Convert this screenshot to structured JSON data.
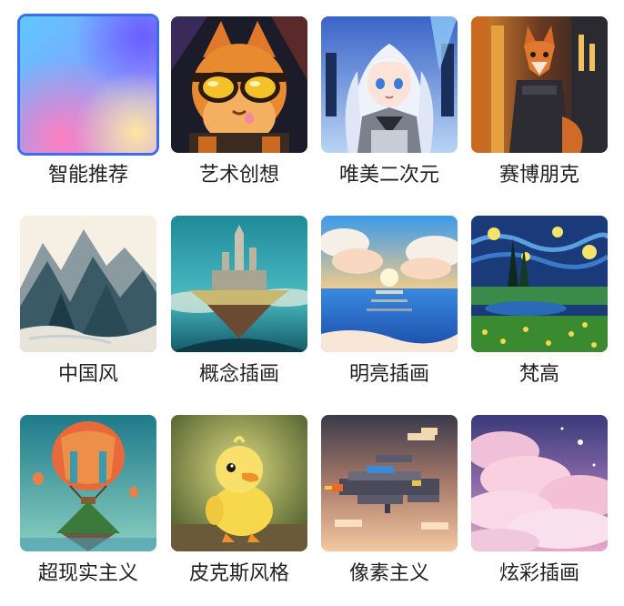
{
  "style_picker": {
    "selected_index": 0,
    "accent_color": "#3b6cf6",
    "styles": [
      {
        "label": "智能推荐",
        "icon": "smart-recommend-gradient-icon"
      },
      {
        "label": "艺术创想",
        "icon": "cat-sunglasses-thumbnail"
      },
      {
        "label": "唯美二次元",
        "icon": "anime-girl-thumbnail"
      },
      {
        "label": "赛博朋克",
        "icon": "cyberpunk-fox-thumbnail"
      },
      {
        "label": "中国风",
        "icon": "ink-mountains-thumbnail"
      },
      {
        "label": "概念插画",
        "icon": "floating-island-thumbnail"
      },
      {
        "label": "明亮插画",
        "icon": "sunset-sea-thumbnail"
      },
      {
        "label": "梵高",
        "icon": "starry-night-thumbnail"
      },
      {
        "label": "超现实主义",
        "icon": "hot-air-balloon-thumbnail"
      },
      {
        "label": "皮克斯风格",
        "icon": "duckling-thumbnail"
      },
      {
        "label": "像素主义",
        "icon": "pixel-spaceship-thumbnail"
      },
      {
        "label": "炫彩插画",
        "icon": "pastel-clouds-thumbnail"
      }
    ]
  }
}
